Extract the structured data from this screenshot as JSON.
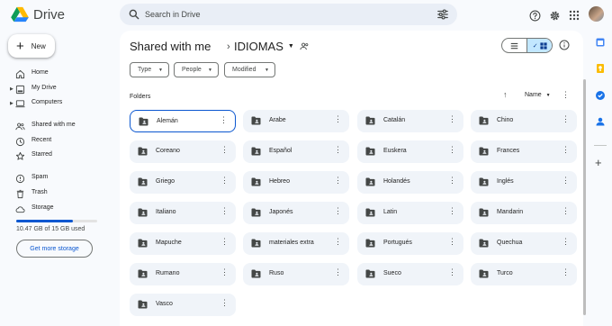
{
  "app": {
    "name": "Drive"
  },
  "search": {
    "placeholder": "Search in Drive"
  },
  "new_button": {
    "label": "New"
  },
  "nav": [
    {
      "label": "Home",
      "icon": "home-icon",
      "caret": false
    },
    {
      "label": "My Drive",
      "icon": "my-drive-icon",
      "caret": true
    },
    {
      "label": "Computers",
      "icon": "computers-icon",
      "caret": true
    },
    {
      "label": "Shared with me",
      "icon": "shared-icon",
      "caret": false
    },
    {
      "label": "Recent",
      "icon": "clock-icon",
      "caret": false
    },
    {
      "label": "Starred",
      "icon": "star-icon",
      "caret": false
    },
    {
      "label": "Spam",
      "icon": "spam-icon",
      "caret": false
    },
    {
      "label": "Trash",
      "icon": "trash-icon",
      "caret": false
    },
    {
      "label": "Storage",
      "icon": "cloud-icon",
      "caret": false
    }
  ],
  "storage": {
    "text": "10.47 GB of 15 GB used",
    "used_fraction": 0.698,
    "button_label": "Get more storage"
  },
  "breadcrumb": {
    "parent": "Shared with me",
    "current": "IDIOMAS"
  },
  "filters": {
    "type": "Type",
    "people": "People",
    "modified": "Modified"
  },
  "folders_label": "Folders",
  "sort": {
    "label": "Name"
  },
  "folders": [
    "Alemán",
    "Arabe",
    "Catalán",
    "Chino",
    "Coreano",
    "Español",
    "Euskera",
    "Frances",
    "Griego",
    "Hebreo",
    "Holandés",
    "Inglés",
    "Italiano",
    "Japonés",
    "Latin",
    "Mandarin",
    "Mapuche",
    "materiales extra",
    "Portugués",
    "Quechua",
    "Rumano",
    "Ruso",
    "Sueco",
    "Turco",
    "Vasco"
  ],
  "selected_folder": "Alemán",
  "colors": {
    "accent": "#0b57d0",
    "chip_selected": "#c2e7ff",
    "folder_bg": "#f0f4f9",
    "page_bg": "#f8fafd"
  }
}
